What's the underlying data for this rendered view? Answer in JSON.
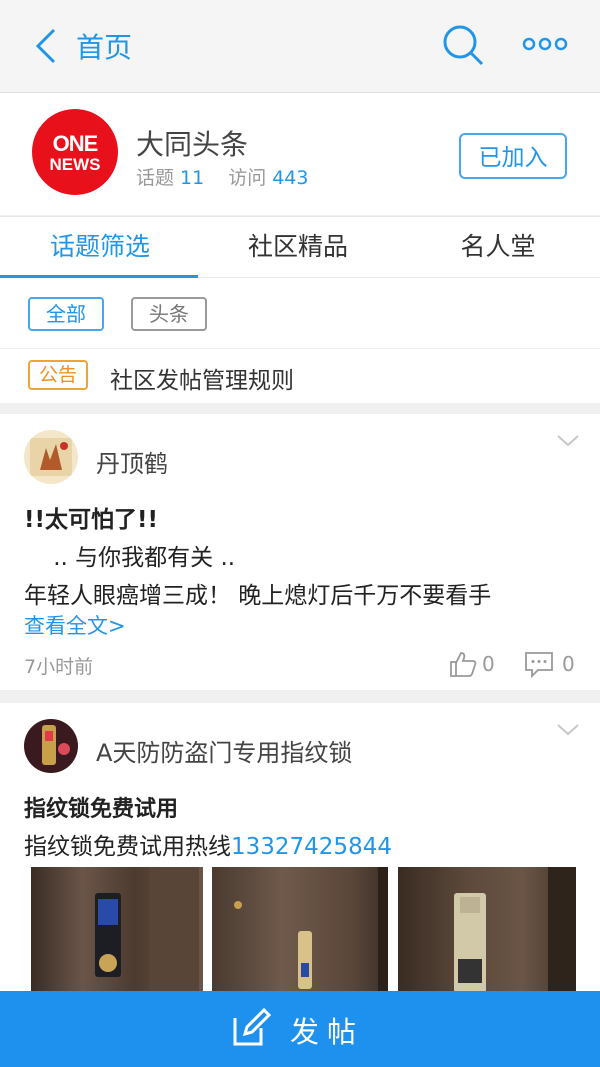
{
  "nav": {
    "title": "首页"
  },
  "community": {
    "name": "大同头条",
    "topics_label": "话题",
    "topics_count": "11",
    "visits_label": "访问",
    "visits_count": "443",
    "join_label": "已加入",
    "logo_line1": "ONE",
    "logo_line2": "NEWS"
  },
  "tabs": [
    {
      "label": "话题筛选"
    },
    {
      "label": "社区精品"
    },
    {
      "label": "名人堂"
    }
  ],
  "filters": [
    {
      "label": "全部"
    },
    {
      "label": "头条"
    }
  ],
  "notice": {
    "tag": "公告",
    "text": "社区发帖管理规则"
  },
  "posts": [
    {
      "author": "丹顶鹤",
      "lines": [
        "!!太可怕了!!",
        "    .. 与你我都有关 ..",
        "年轻人眼癌增三成！ 晚上熄灯后千万不要看手"
      ],
      "more_link": "查看全文>",
      "time": "7小时前",
      "likes": "0",
      "comments": "0"
    },
    {
      "author": "A天防防盗门专用指纹锁",
      "title": "指纹锁免费试用",
      "body_prefix": "指纹锁免费试用热线",
      "phone": "13327425844"
    }
  ],
  "fab": {
    "label": "发帖"
  },
  "colors": {
    "accent": "#2196e8",
    "fab": "#1e90ee",
    "notice": "#f09020"
  }
}
